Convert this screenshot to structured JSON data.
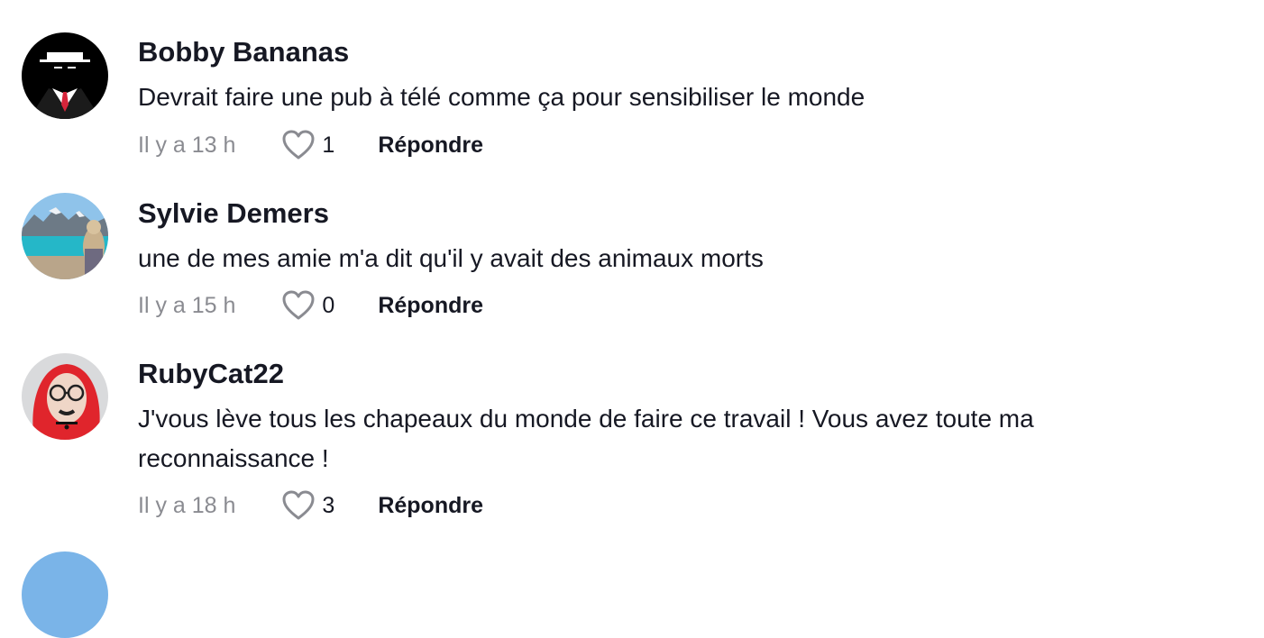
{
  "comments": [
    {
      "username": "Bobby Bananas",
      "text": "Devrait faire une pub à télé comme ça pour sensibiliser le monde",
      "time": "Il y a 13 h",
      "likes": "1",
      "reply_label": "Répondre",
      "avatar_icon": "hat-man-icon"
    },
    {
      "username": "Sylvie Demers",
      "text": "une de mes amie m'a dit qu'il y avait des animaux morts",
      "time": "Il y a 15 h",
      "likes": "0",
      "reply_label": "Répondre",
      "avatar_icon": "lake-photo"
    },
    {
      "username": "RubyCat22",
      "text": "J'vous lève tous les chapeaux du monde de faire ce travail ! Vous avez toute ma reconnaissance !",
      "time": "Il y a 18 h",
      "likes": "3",
      "reply_label": "Répondre",
      "avatar_icon": "red-hair-photo"
    }
  ],
  "colors": {
    "text": "#161823",
    "muted": "#8a8b91",
    "heart_outline": "#8a8b91"
  }
}
